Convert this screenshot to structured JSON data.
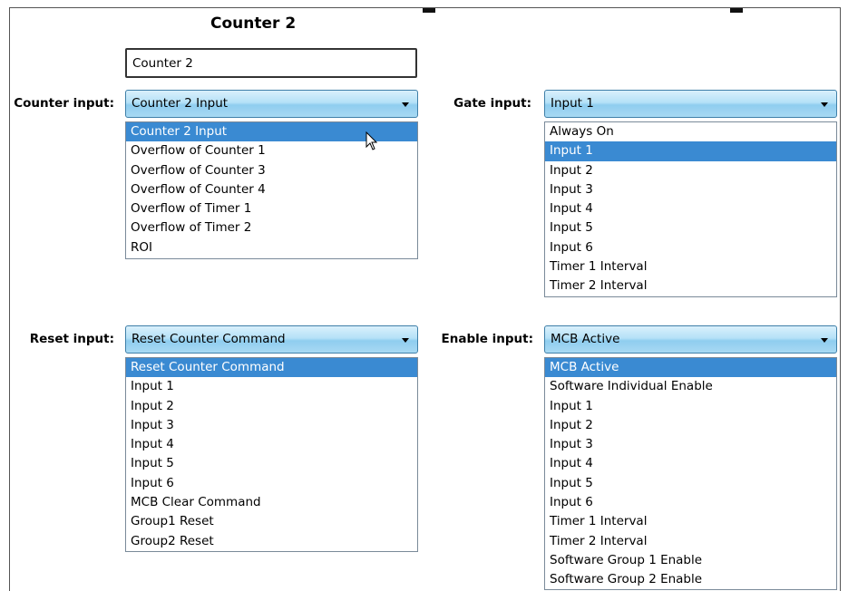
{
  "title": "Counter 2",
  "name_field": {
    "value": "Counter 2"
  },
  "counter_input": {
    "label": "Counter input:",
    "selected": "Counter 2 Input",
    "options": [
      "Counter 2 Input",
      "Overflow of Counter 1",
      "Overflow of Counter 3",
      "Overflow of Counter 4",
      "Overflow of Timer 1",
      "Overflow of Timer 2",
      "ROI"
    ],
    "highlighted_index": 0
  },
  "gate_input": {
    "label": "Gate input:",
    "selected": "Input 1",
    "options": [
      "Always On",
      "Input 1",
      "Input 2",
      "Input 3",
      "Input 4",
      "Input 5",
      "Input 6",
      "Timer 1 Interval",
      "Timer 2 Interval"
    ],
    "highlighted_index": 1
  },
  "reset_input": {
    "label": "Reset input:",
    "selected": "Reset Counter Command",
    "options": [
      "Reset Counter Command",
      "Input 1",
      "Input 2",
      "Input 3",
      "Input 4",
      "Input 5",
      "Input 6",
      "MCB Clear Command",
      "Group1 Reset",
      "Group2 Reset"
    ],
    "highlighted_index": 0
  },
  "enable_input": {
    "label": "Enable input:",
    "selected": "MCB Active",
    "options": [
      "MCB Active",
      "Software Individual Enable",
      "Input 1",
      "Input 2",
      "Input 3",
      "Input 4",
      "Input 5",
      "Input 6",
      "Timer 1 Interval",
      "Timer 2 Interval",
      "Software Group 1 Enable",
      "Software Group 2 Enable"
    ],
    "highlighted_index": 0
  },
  "colors": {
    "highlight": "#3a8ad2",
    "combo_border": "#3e7fa8"
  },
  "icons": {
    "dropdown_arrow": "chevron-down-icon",
    "cursor": "mouse-pointer-icon"
  }
}
